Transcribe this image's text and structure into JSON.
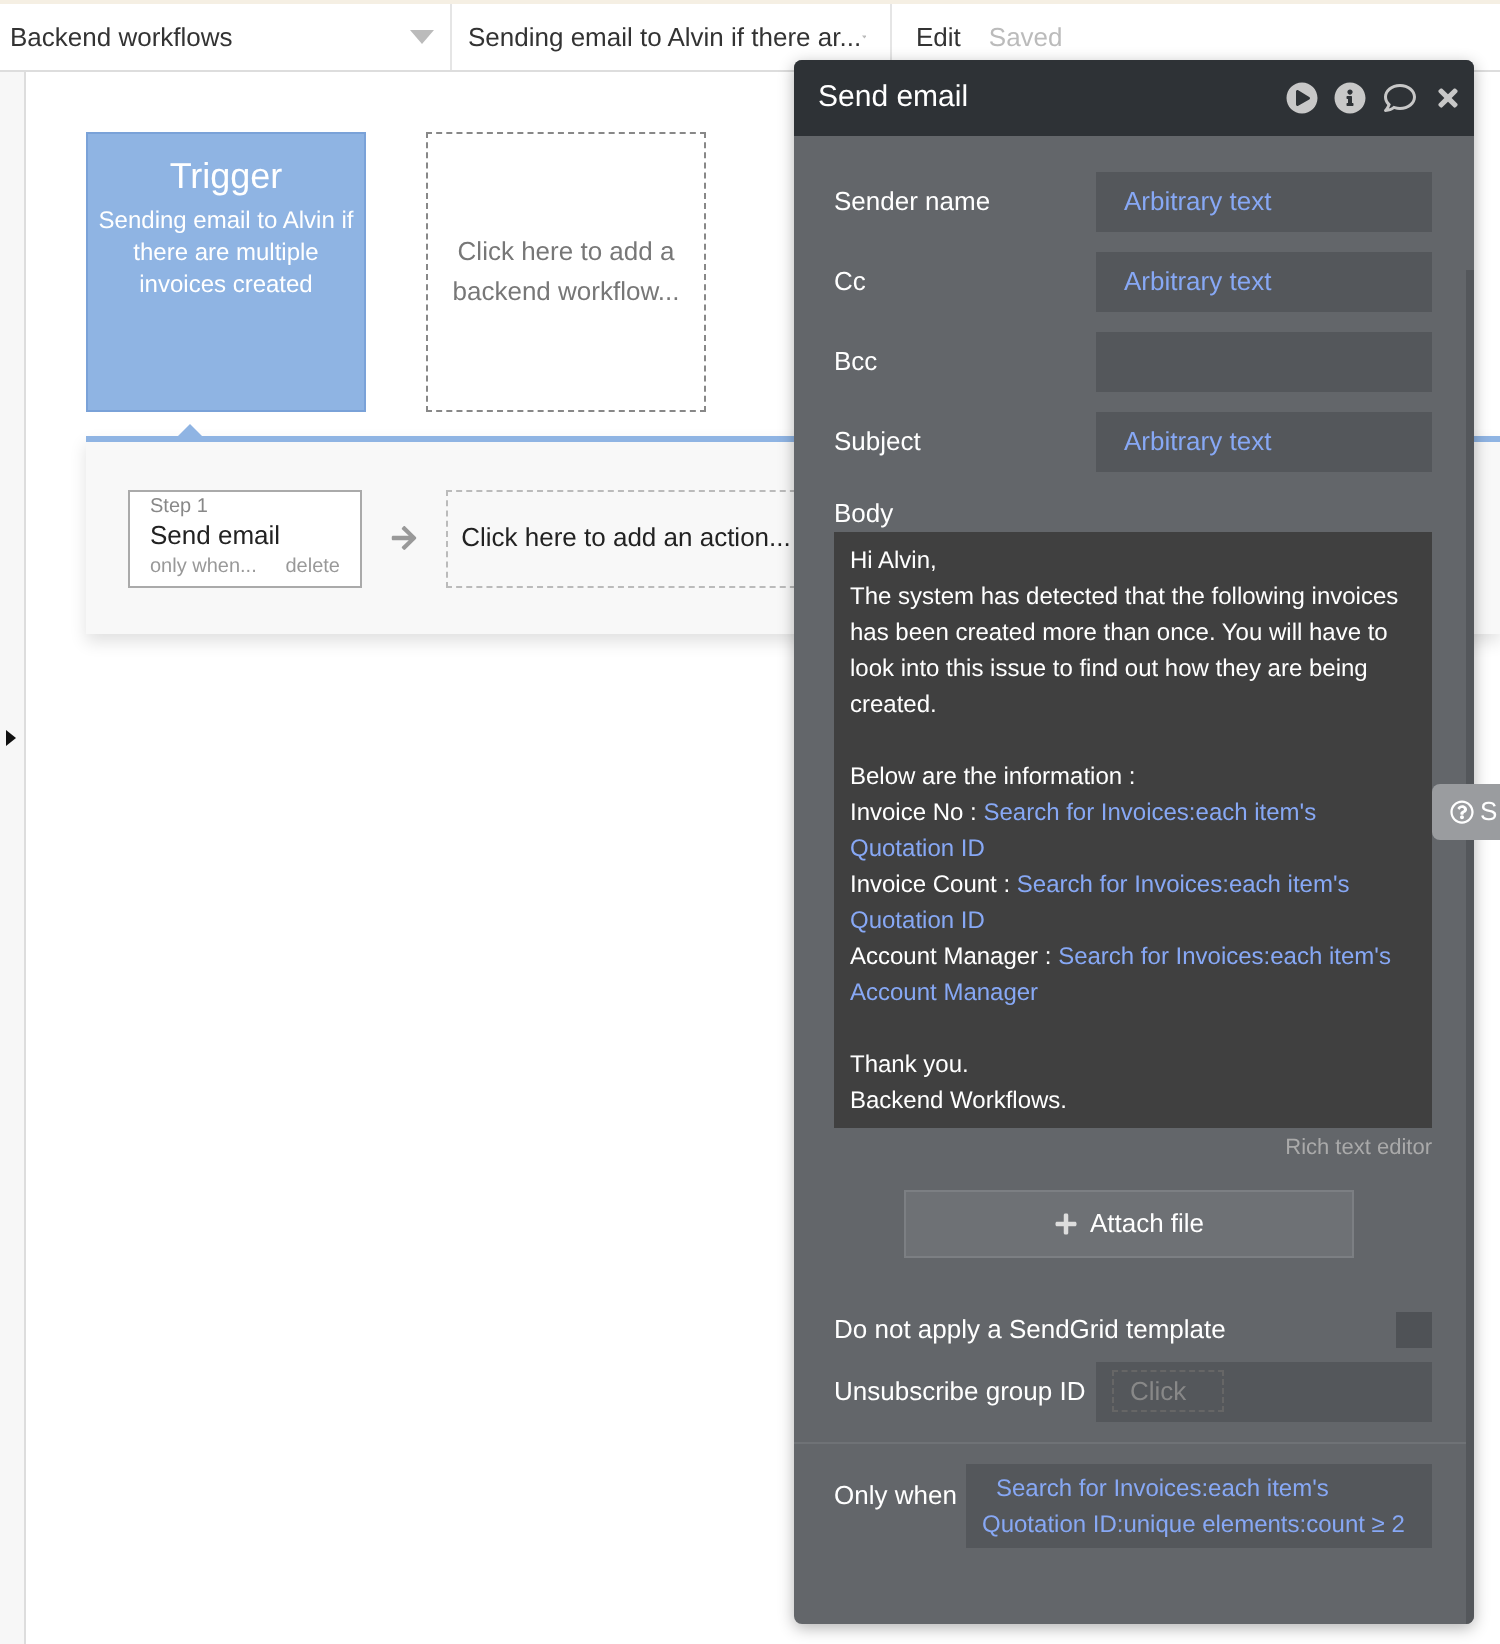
{
  "top_bar": {
    "page_dropdown": "Backend workflows",
    "workflow_dropdown": "Sending email to Alvin if there ar...",
    "edit_tab": "Edit",
    "save_status": "Saved"
  },
  "canvas": {
    "trigger": {
      "title": "Trigger",
      "name": "Sending email to Alvin if there are multiple invoices created",
      "selected": true
    },
    "add_workflow": "Click here to add a backend workflow...",
    "steps": [
      {
        "step": "Step 1",
        "action": "Send email",
        "condition": "only when...",
        "delete": "delete"
      }
    ],
    "add_action": "Click here to add an action..."
  },
  "panel": {
    "title": "Send email",
    "fields": [
      {
        "label": "Sender name",
        "value": "Arbitrary text"
      },
      {
        "label": "Cc",
        "value": "Arbitrary text"
      },
      {
        "label": "Bcc"
      },
      {
        "label": "Subject",
        "value": "Arbitrary text"
      }
    ],
    "body": {
      "label": "Body",
      "paragraphs": [
        {
          "lines": [
            {
              "text": "Hi Alvin,"
            },
            {
              "text": "The system has detected that the following invoices has been created more than once. You will have to look into this issue to find out how they are being created."
            }
          ]
        },
        {
          "lines": [
            {
              "text": "Below are the information :"
            },
            {
              "text": "Invoice No :",
              "expression": "Search for Invoices:each item's Quotation ID"
            },
            {
              "text": "Invoice Count :",
              "expression": "Search for Invoices:each item's Quotation ID"
            },
            {
              "text": "Account Manager :",
              "expression": "Search for Invoices:each item's Account Manager"
            }
          ]
        },
        {
          "lines": [
            {
              "text": "Thank you."
            },
            {
              "text": "Backend Workflows."
            }
          ]
        }
      ]
    },
    "rich_text_editor": "Rich text editor",
    "attach_button": "Attach file",
    "sendgrid": {
      "label": "Do not apply a SendGrid template",
      "checked": false
    },
    "unsubscribe": {
      "label": "Unsubscribe group ID",
      "placeholder": "Click"
    },
    "only_when": {
      "label": "Only when",
      "expression": "Search for Invoices:each item's Quotation ID:unique elements:count ≥ 2"
    }
  },
  "help_tab": "S"
}
